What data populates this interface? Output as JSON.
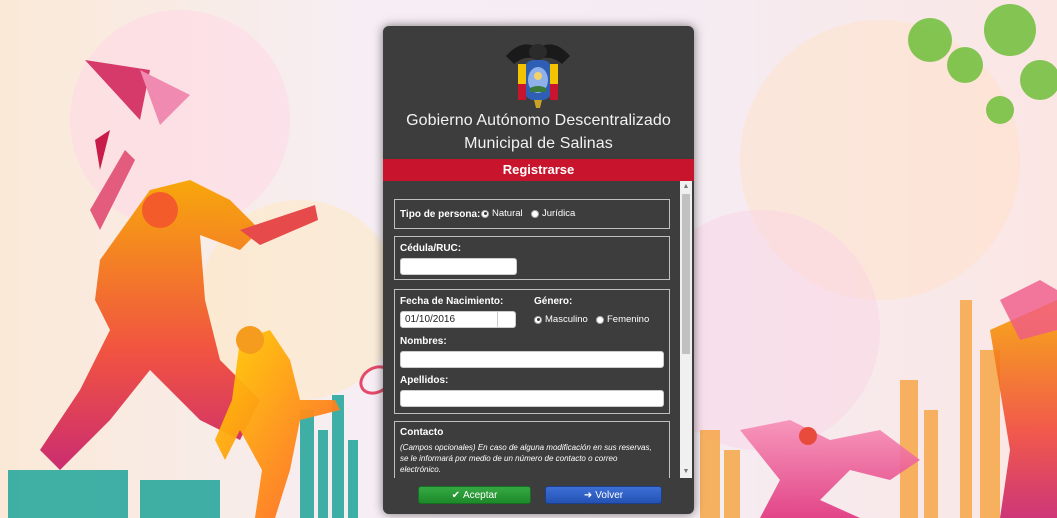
{
  "org": {
    "line1": "Gobierno Autónomo Descentralizado",
    "line2": "Municipal de Salinas"
  },
  "form": {
    "title": "Registrarse",
    "tipo_persona": {
      "label": "Tipo de persona:",
      "options": [
        "Natural",
        "Jurídica"
      ],
      "selected": "Natural"
    },
    "cedula": {
      "label": "Cédula/RUC:",
      "value": ""
    },
    "fecha_nacimiento": {
      "label": "Fecha de Nacimiento:",
      "value": "01/10/2016"
    },
    "genero": {
      "label": "Género:",
      "options": [
        "Masculino",
        "Femenino"
      ],
      "selected": "Masculino"
    },
    "nombres": {
      "label": "Nombres:",
      "value": ""
    },
    "apellidos": {
      "label": "Apellidos:",
      "value": ""
    },
    "contacto": {
      "label": "Contacto",
      "note": "(Campos opcionales) En caso de alguna modificación en sus reservas, se le informará por medio de un número de contacto o correo electrónico."
    }
  },
  "buttons": {
    "accept": "Aceptar",
    "back": "Volver"
  },
  "colors": {
    "panel": "#3d3d3d",
    "header_bar": "#c8152d",
    "accept": "#28a745",
    "back": "#2f60c8"
  },
  "icons": {
    "accept": "check-icon",
    "back": "sign-in-icon"
  }
}
